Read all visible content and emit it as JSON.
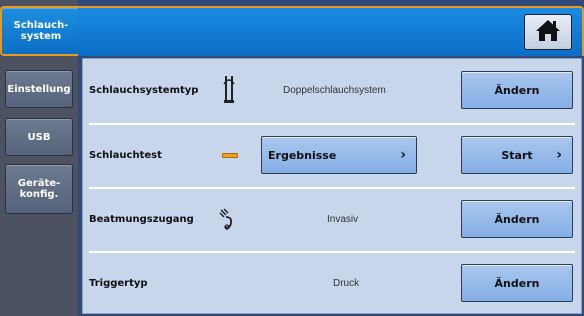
{
  "sidebar": {
    "tabs": [
      {
        "label": "Schlauch-\nsystem",
        "active": true
      },
      {
        "label": "Einstellung"
      },
      {
        "label": "USB"
      },
      {
        "label": "Geräte-\nkonfig."
      }
    ]
  },
  "header": {
    "home_icon": "home-icon"
  },
  "rows": [
    {
      "label": "Schlauchsystemtyp",
      "icon": "dual-tube-icon",
      "value": "Doppelschlauchsystem",
      "button": "Ändern"
    },
    {
      "label": "Schlauchtest",
      "icon": "status-bar-icon",
      "status_color": "#f0a020",
      "results_button": "Ergebnisse",
      "button": "Start"
    },
    {
      "label": "Beatmungszugang",
      "icon": "patient-interface-icon",
      "value": "Invasiv",
      "button": "Ändern"
    },
    {
      "label": "Triggertyp",
      "value": "Druck",
      "button": "Ändern"
    }
  ],
  "colors": {
    "accent": "#e79a1b",
    "header_blue": "#0b6ec6",
    "panel": "#c8d6ec"
  }
}
